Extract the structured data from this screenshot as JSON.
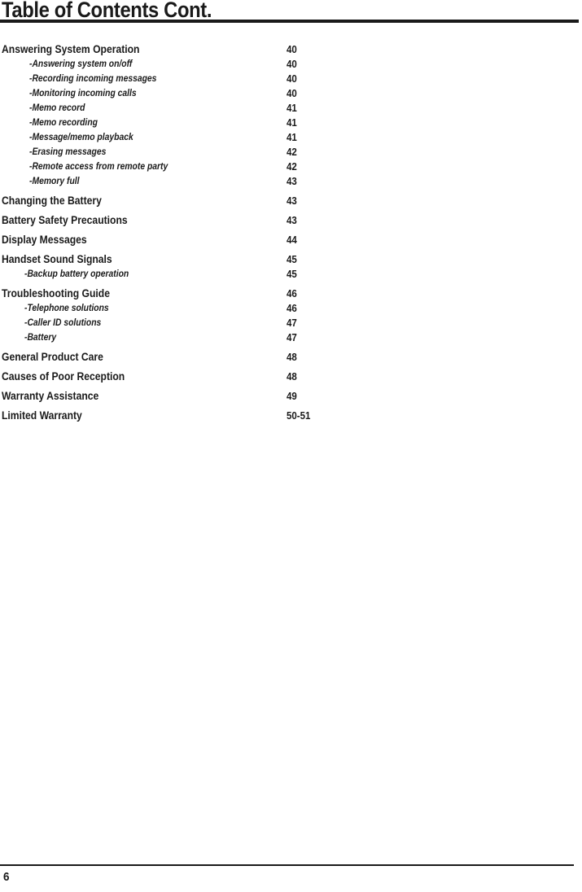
{
  "header": {
    "title": "Table of Contents Cont."
  },
  "toc": {
    "entries": [
      {
        "label": "Answering System Operation",
        "page": "40",
        "level": 0,
        "group_start": false,
        "indent": "normal"
      },
      {
        "label": "-Answering system on/off",
        "page": "40",
        "level": 1,
        "group_start": false,
        "indent": "normal"
      },
      {
        "label": "-Recording incoming messages",
        "page": "40",
        "level": 1,
        "group_start": false,
        "indent": "normal"
      },
      {
        "label": "-Monitoring incoming calls",
        "page": "40",
        "level": 1,
        "group_start": false,
        "indent": "normal"
      },
      {
        "label": "-Memo record",
        "page": "41",
        "level": 1,
        "group_start": false,
        "indent": "normal"
      },
      {
        "label": "-Memo recording",
        "page": "41",
        "level": 1,
        "group_start": false,
        "indent": "normal"
      },
      {
        "label": "-Message/memo playback",
        "page": "41",
        "level": 1,
        "group_start": false,
        "indent": "normal"
      },
      {
        "label": "-Erasing messages",
        "page": "42",
        "level": 1,
        "group_start": false,
        "indent": "normal"
      },
      {
        "label": "-Remote access from remote party",
        "page": "42",
        "level": 1,
        "group_start": false,
        "indent": "normal"
      },
      {
        "label": "-Memory full",
        "page": "43",
        "level": 1,
        "group_start": false,
        "indent": "normal"
      },
      {
        "label": "Changing the Battery",
        "page": "43",
        "level": 0,
        "group_start": true,
        "indent": "normal"
      },
      {
        "label": "Battery Safety Precautions",
        "page": "43",
        "level": 0,
        "group_start": true,
        "indent": "normal"
      },
      {
        "label": "Display Messages",
        "page": "44",
        "level": 0,
        "group_start": true,
        "indent": "normal"
      },
      {
        "label": "Handset Sound Signals",
        "page": "45",
        "level": 0,
        "group_start": true,
        "indent": "normal"
      },
      {
        "label": "-Backup battery operation",
        "page": "45",
        "level": 1,
        "group_start": false,
        "indent": "small"
      },
      {
        "label": "Troubleshooting Guide",
        "page": "46",
        "level": 0,
        "group_start": true,
        "indent": "normal"
      },
      {
        "label": "-Telephone solutions",
        "page": "46",
        "level": 1,
        "group_start": false,
        "indent": "small"
      },
      {
        "label": "-Caller ID solutions",
        "page": "47",
        "level": 1,
        "group_start": false,
        "indent": "small"
      },
      {
        "label": "-Battery",
        "page": "47",
        "level": 1,
        "group_start": false,
        "indent": "small"
      },
      {
        "label": "General Product Care",
        "page": "48",
        "level": 0,
        "group_start": true,
        "indent": "normal"
      },
      {
        "label": "Causes of Poor Reception",
        "page": "48",
        "level": 0,
        "group_start": true,
        "indent": "normal"
      },
      {
        "label": "Warranty Assistance",
        "page": "49",
        "level": 0,
        "group_start": true,
        "indent": "normal"
      },
      {
        "label": "Limited Warranty",
        "page": "50-51",
        "level": 0,
        "group_start": true,
        "indent": "normal"
      }
    ]
  },
  "footer": {
    "page_number": "6"
  }
}
